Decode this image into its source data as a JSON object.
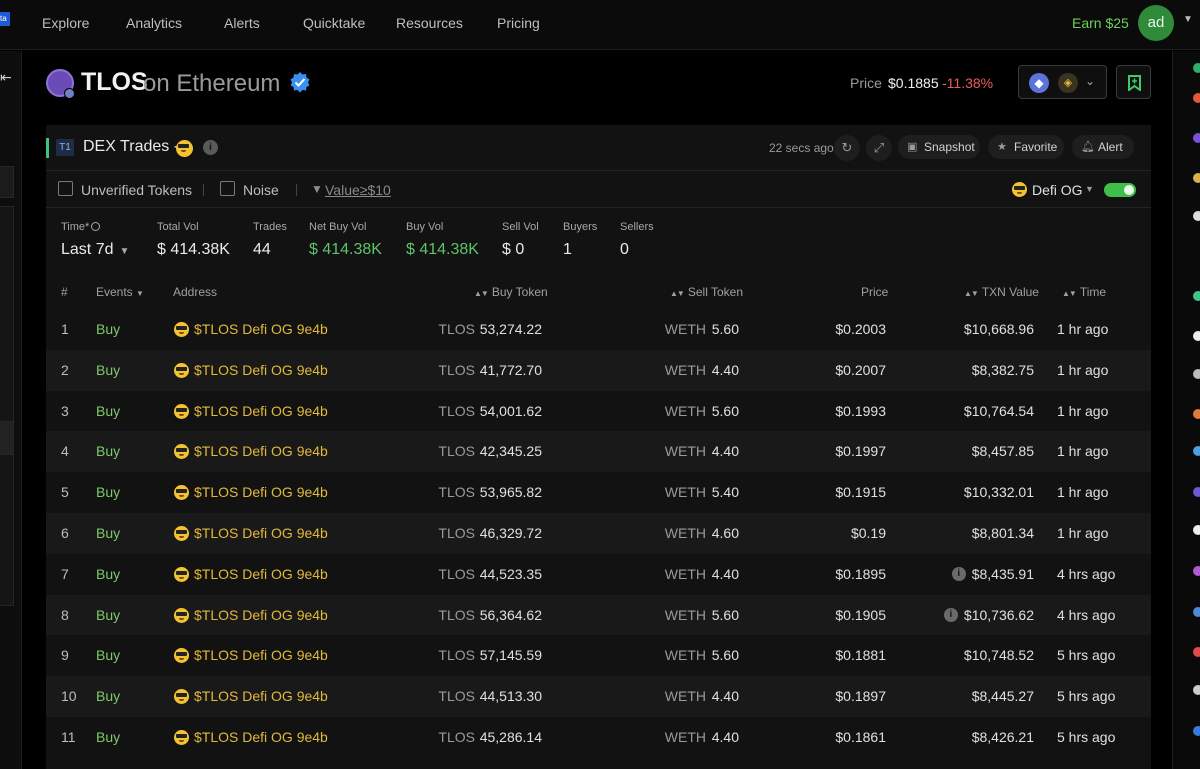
{
  "nav": {
    "stub": "ta",
    "items": [
      "Explore",
      "Analytics",
      "Alerts",
      "Quicktake",
      "Resources",
      "Pricing"
    ],
    "earn": "Earn $25",
    "avatar": "ad"
  },
  "token": {
    "symbol": "TLOS",
    "chain_text": "on Ethereum",
    "price_label": "Price",
    "price": "$0.1885",
    "change": "-11.38%",
    "colors": {
      "accent": "#41c27a",
      "negative": "#ec5b5b",
      "positive": "#5cc46a"
    }
  },
  "panel": {
    "badge": "T1",
    "title": "DEX Trades -",
    "updated": "22 secs ago",
    "snapshot": "Snapshot",
    "favorite": "Favorite",
    "alert": "Alert"
  },
  "filters": {
    "unverified": "Unverified Tokens",
    "noise": "Noise",
    "value": "Value≥$10",
    "entity": "Defi OG"
  },
  "stats": [
    {
      "label": "Time*",
      "value": "Last 7d",
      "tone": "plain"
    },
    {
      "label": "Total Vol",
      "value": "$ 414.38K",
      "tone": "plain"
    },
    {
      "label": "Trades",
      "value": "44",
      "tone": "plain"
    },
    {
      "label": "Net Buy Vol",
      "value": "$ 414.38K",
      "tone": "green"
    },
    {
      "label": "Buy Vol",
      "value": "$ 414.38K",
      "tone": "green"
    },
    {
      "label": "Sell Vol",
      "value": "$ 0",
      "tone": "plain"
    },
    {
      "label": "Buyers",
      "value": "1",
      "tone": "plain"
    },
    {
      "label": "Sellers",
      "value": "0",
      "tone": "plain"
    }
  ],
  "table": {
    "headers": {
      "index": "#",
      "events": "Events",
      "address": "Address",
      "buy_token": "Buy Token",
      "sell_token": "Sell Token",
      "price": "Price",
      "txn_value": "TXN Value",
      "time": "Time"
    },
    "rows": [
      {
        "n": "1",
        "event": "Buy",
        "address": "$TLOS Defi OG 9e4b",
        "buy_sym": "TLOS",
        "buy_amt": "53,274.22",
        "sell_sym": "WETH",
        "sell_amt": "5.60",
        "price": "$0.2003",
        "value": "$10,668.96",
        "time": "1 hr ago",
        "flag": false
      },
      {
        "n": "2",
        "event": "Buy",
        "address": "$TLOS Defi OG 9e4b",
        "buy_sym": "TLOS",
        "buy_amt": "41,772.70",
        "sell_sym": "WETH",
        "sell_amt": "4.40",
        "price": "$0.2007",
        "value": "$8,382.75",
        "time": "1 hr ago",
        "flag": false
      },
      {
        "n": "3",
        "event": "Buy",
        "address": "$TLOS Defi OG 9e4b",
        "buy_sym": "TLOS",
        "buy_amt": "54,001.62",
        "sell_sym": "WETH",
        "sell_amt": "5.60",
        "price": "$0.1993",
        "value": "$10,764.54",
        "time": "1 hr ago",
        "flag": false
      },
      {
        "n": "4",
        "event": "Buy",
        "address": "$TLOS Defi OG 9e4b",
        "buy_sym": "TLOS",
        "buy_amt": "42,345.25",
        "sell_sym": "WETH",
        "sell_amt": "4.40",
        "price": "$0.1997",
        "value": "$8,457.85",
        "time": "1 hr ago",
        "flag": false
      },
      {
        "n": "5",
        "event": "Buy",
        "address": "$TLOS Defi OG 9e4b",
        "buy_sym": "TLOS",
        "buy_amt": "53,965.82",
        "sell_sym": "WETH",
        "sell_amt": "5.40",
        "price": "$0.1915",
        "value": "$10,332.01",
        "time": "1 hr ago",
        "flag": false
      },
      {
        "n": "6",
        "event": "Buy",
        "address": "$TLOS Defi OG 9e4b",
        "buy_sym": "TLOS",
        "buy_amt": "46,329.72",
        "sell_sym": "WETH",
        "sell_amt": "4.60",
        "price": "$0.19",
        "value": "$8,801.34",
        "time": "1 hr ago",
        "flag": false
      },
      {
        "n": "7",
        "event": "Buy",
        "address": "$TLOS Defi OG 9e4b",
        "buy_sym": "TLOS",
        "buy_amt": "44,523.35",
        "sell_sym": "WETH",
        "sell_amt": "4.40",
        "price": "$0.1895",
        "value": "$8,435.91",
        "time": "4 hrs ago",
        "flag": true
      },
      {
        "n": "8",
        "event": "Buy",
        "address": "$TLOS Defi OG 9e4b",
        "buy_sym": "TLOS",
        "buy_amt": "56,364.62",
        "sell_sym": "WETH",
        "sell_amt": "5.60",
        "price": "$0.1905",
        "value": "$10,736.62",
        "time": "4 hrs ago",
        "flag": true
      },
      {
        "n": "9",
        "event": "Buy",
        "address": "$TLOS Defi OG 9e4b",
        "buy_sym": "TLOS",
        "buy_amt": "57,145.59",
        "sell_sym": "WETH",
        "sell_amt": "5.60",
        "price": "$0.1881",
        "value": "$10,748.52",
        "time": "5 hrs ago",
        "flag": false
      },
      {
        "n": "10",
        "event": "Buy",
        "address": "$TLOS Defi OG 9e4b",
        "buy_sym": "TLOS",
        "buy_amt": "44,513.30",
        "sell_sym": "WETH",
        "sell_amt": "4.40",
        "price": "$0.1897",
        "value": "$8,445.27",
        "time": "5 hrs ago",
        "flag": false
      },
      {
        "n": "11",
        "event": "Buy",
        "address": "$TLOS Defi OG 9e4b",
        "buy_sym": "TLOS",
        "buy_amt": "45,286.14",
        "sell_sym": "WETH",
        "sell_amt": "4.40",
        "price": "$0.1861",
        "value": "$8,426.21",
        "time": "5 hrs ago",
        "flag": false
      }
    ]
  }
}
